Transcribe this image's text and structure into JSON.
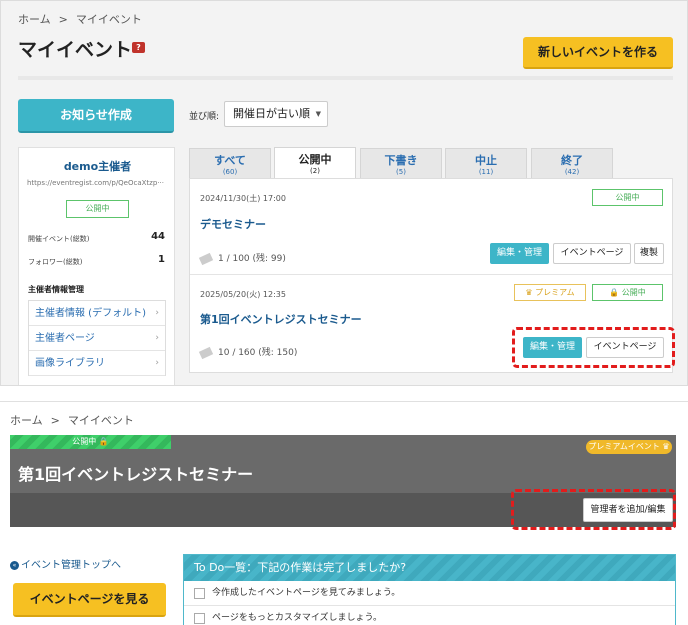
{
  "top": {
    "breadcrumb": {
      "home": "ホーム",
      "sep": ">",
      "current": "マイイベント"
    },
    "title": "マイイベント",
    "help_badge": "?",
    "new_event_button": "新しいイベントを作る",
    "news_button": "お知らせ作成",
    "sort": {
      "label": "並び順:",
      "selected": "開催日が古い順"
    },
    "organizer": {
      "name": "demo主催者",
      "url": "https://eventregist.com/p/QeOcaXtzp···",
      "status": "公開中",
      "events_label": "開催イベント(総数)",
      "events_count": "44",
      "followers_label": "フォロワー(総数)",
      "followers_count": "1",
      "section_title": "主催者情報管理",
      "menu": [
        "主催者情報 (デフォルト)",
        "主催者ページ",
        "画像ライブラリ"
      ]
    },
    "tabs": [
      {
        "label": "すべて",
        "count": "(60)"
      },
      {
        "label": "公開中",
        "count": "(2)"
      },
      {
        "label": "下書き",
        "count": "(5)"
      },
      {
        "label": "中止",
        "count": "(11)"
      },
      {
        "label": "終了",
        "count": "(42)"
      }
    ],
    "events": [
      {
        "date": "2024/11/30(土) 17:00",
        "title": "デモセミナー",
        "capacity": "1 / 100 (残: 99)",
        "status": "公開中",
        "buttons": {
          "edit": "編集・管理",
          "page": "イベントページ",
          "copy": "複製"
        }
      },
      {
        "date": "2025/05/20(火) 12:35",
        "title": "第1回イベントレジストセミナー",
        "capacity": "10 / 160 (残: 150)",
        "premium": "プレミアム",
        "status": "公開中",
        "buttons": {
          "edit": "編集・管理",
          "page": "イベントページ"
        }
      }
    ]
  },
  "bottom": {
    "breadcrumb": {
      "home": "ホーム",
      "sep": ">",
      "current": "マイイベント"
    },
    "status_bar": "公開中",
    "premium_badge": "プレミアムイベント",
    "event_title": "第1回イベントレジストセミナー",
    "admin_button": "管理者を追加/編集",
    "back_link": "イベント管理トップへ",
    "view_page_button": "イベントページを見る",
    "todo": {
      "header": "To Do一覧：下記の作業は完了しましたか?",
      "items": [
        "今作成したイベントページを見てみましょう。",
        "ページをもっとカスタマイズしましょう。"
      ]
    }
  },
  "colors": {
    "accent_teal": "#3db5c8",
    "accent_yellow": "#f6c022",
    "highlight_red": "#e21c1c",
    "status_green": "#4aaf5a"
  }
}
